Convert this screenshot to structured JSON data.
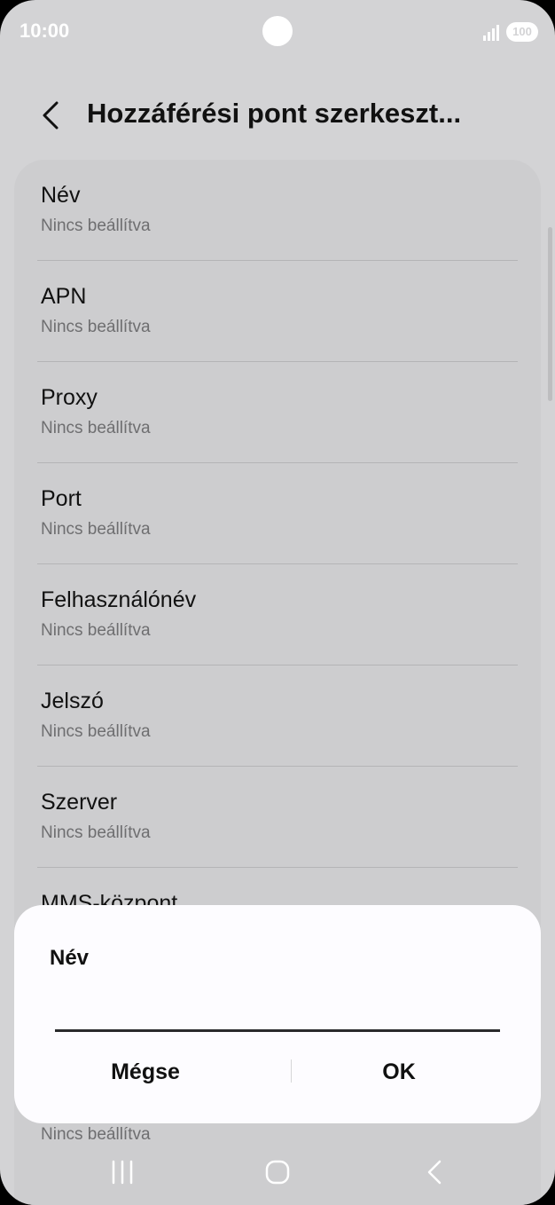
{
  "status_bar": {
    "time": "10:00",
    "battery": "100",
    "icons": [
      "camera-hole",
      "signal-icon",
      "battery-icon"
    ]
  },
  "header": {
    "back_icon": "chevron-left-icon",
    "title": "Hozzáférési pont szerkeszt..."
  },
  "list": {
    "items": [
      {
        "label": "Név",
        "value": "Nincs beállítva"
      },
      {
        "label": "APN",
        "value": "Nincs beállítva"
      },
      {
        "label": "Proxy",
        "value": "Nincs beállítva"
      },
      {
        "label": "Port",
        "value": "Nincs beállítva"
      },
      {
        "label": "Felhasználónév",
        "value": "Nincs beállítva"
      },
      {
        "label": "Jelszó",
        "value": "Nincs beállítva"
      },
      {
        "label": "Szerver",
        "value": "Nincs beállítva"
      },
      {
        "label": "MMS-központ",
        "value": ""
      }
    ],
    "peek_value": "Nincs beállítva"
  },
  "dialog": {
    "title": "Név",
    "input_value": "",
    "cancel_label": "Mégse",
    "ok_label": "OK"
  },
  "nav_bar": {
    "icons": [
      "recents-icon",
      "home-icon",
      "back-icon"
    ]
  },
  "colors": {
    "background": "#d3d3d5",
    "card": "#cdcdcf",
    "dialog": "#fdfcff",
    "text_primary": "#111111",
    "text_secondary": "#6e6e70"
  }
}
